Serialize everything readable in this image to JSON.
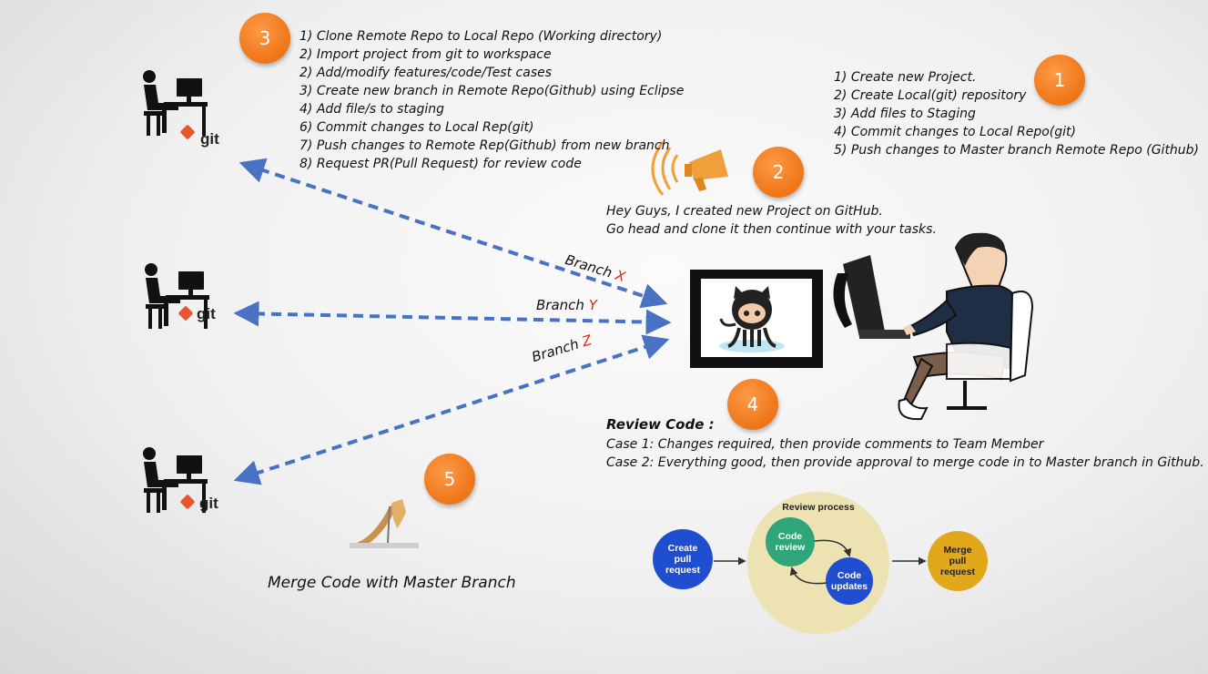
{
  "steps_clone": [
    "1) Clone Remote Repo to Local Repo (Working directory)",
    "2) Import project from git to workspace",
    "2) Add/modify features/code/Test cases",
    "3) Create new branch in Remote Repo(Github) using Eclipse",
    "4) Add file/s to staging",
    "6) Commit changes to Local Rep(git)",
    "7) Push changes to Remote Rep(Github) from new branch",
    "8) Request PR(Pull Request) for review code"
  ],
  "steps_create": [
    "1) Create new Project.",
    "2) Create Local(git) repository",
    "3) Add files to Staging",
    "4) Commit changes to Local Repo(git)",
    "5) Push changes to Master branch Remote Repo (Github)"
  ],
  "announcement": [
    "Hey Guys, I created new Project on GitHub.",
    "Go head and clone it then continue with your tasks."
  ],
  "badges": {
    "b1": "1",
    "b2": "2",
    "b3": "3",
    "b4": "4",
    "b5": "5"
  },
  "branches": {
    "x": {
      "word": "Branch",
      "letter": "X"
    },
    "y": {
      "word": "Branch",
      "letter": "Y"
    },
    "z": {
      "word": "Branch",
      "letter": "Z"
    }
  },
  "git_label": "git",
  "review": {
    "title": "Review Code :",
    "case1": "Case 1: Changes required, then provide comments to Team Member",
    "case2": "Case 2: Everything good, then provide approval to merge code in to Master branch in Github."
  },
  "review_process": {
    "title": "Review process",
    "create": [
      "Create",
      "pull",
      "request"
    ],
    "code_review": [
      "Code",
      "review"
    ],
    "code_updates": [
      "Code",
      "updates"
    ],
    "merge": [
      "Merge",
      "pull",
      "request"
    ]
  },
  "merge_caption": "Merge Code with Master Branch",
  "colors": {
    "badge": "#f07a1e",
    "arrow": "#4a72c4",
    "branch_letter": "#e0261c",
    "git_orange": "#e8552f",
    "review_bg": "#ece2b2",
    "create_pr": "#1f4fd0",
    "code_review": "#2fa57a",
    "merge_pr": "#e0a81a"
  }
}
